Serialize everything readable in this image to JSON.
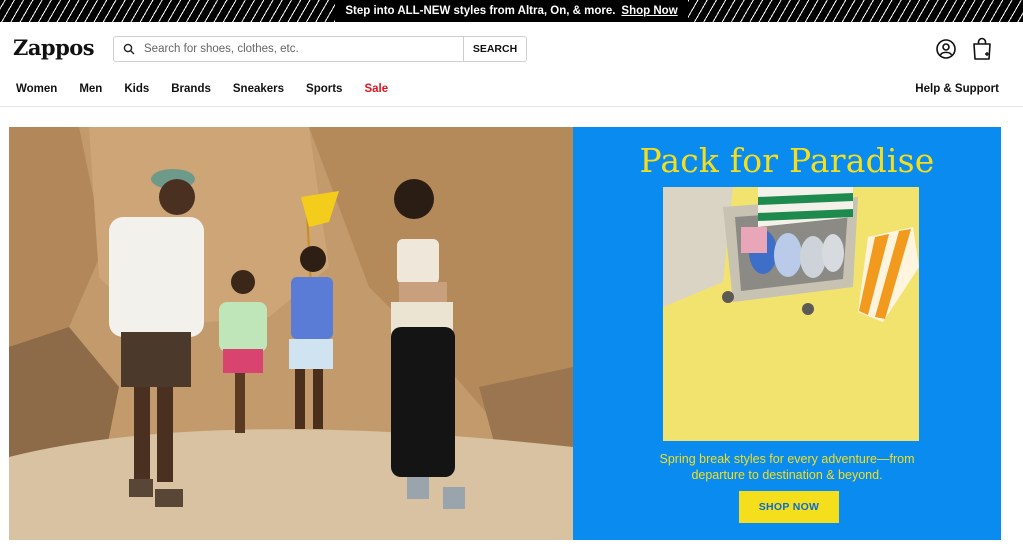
{
  "promo": {
    "text": "Step into ALL-NEW styles from Altra, On, & more.",
    "link": "Shop Now"
  },
  "header": {
    "logo": "Zappos",
    "search_placeholder": "Search for shoes, clothes, etc.",
    "search_button": "SEARCH",
    "icons": [
      "search-icon",
      "account-icon",
      "cart-icon"
    ]
  },
  "nav": {
    "items": [
      "Women",
      "Men",
      "Kids",
      "Brands",
      "Sneakers",
      "Sports",
      "Sale"
    ],
    "help": "Help & Support"
  },
  "hero": {
    "title": "Pack for Paradise",
    "copy_line1": "Spring break styles for every adventure—from",
    "copy_line2": "departure to destination & beyond.",
    "button": "SHOP NOW"
  },
  "colors": {
    "panel_bg": "#0a8bf0",
    "accent_yellow": "#f5df1c",
    "sale_red": "#e1141d"
  }
}
